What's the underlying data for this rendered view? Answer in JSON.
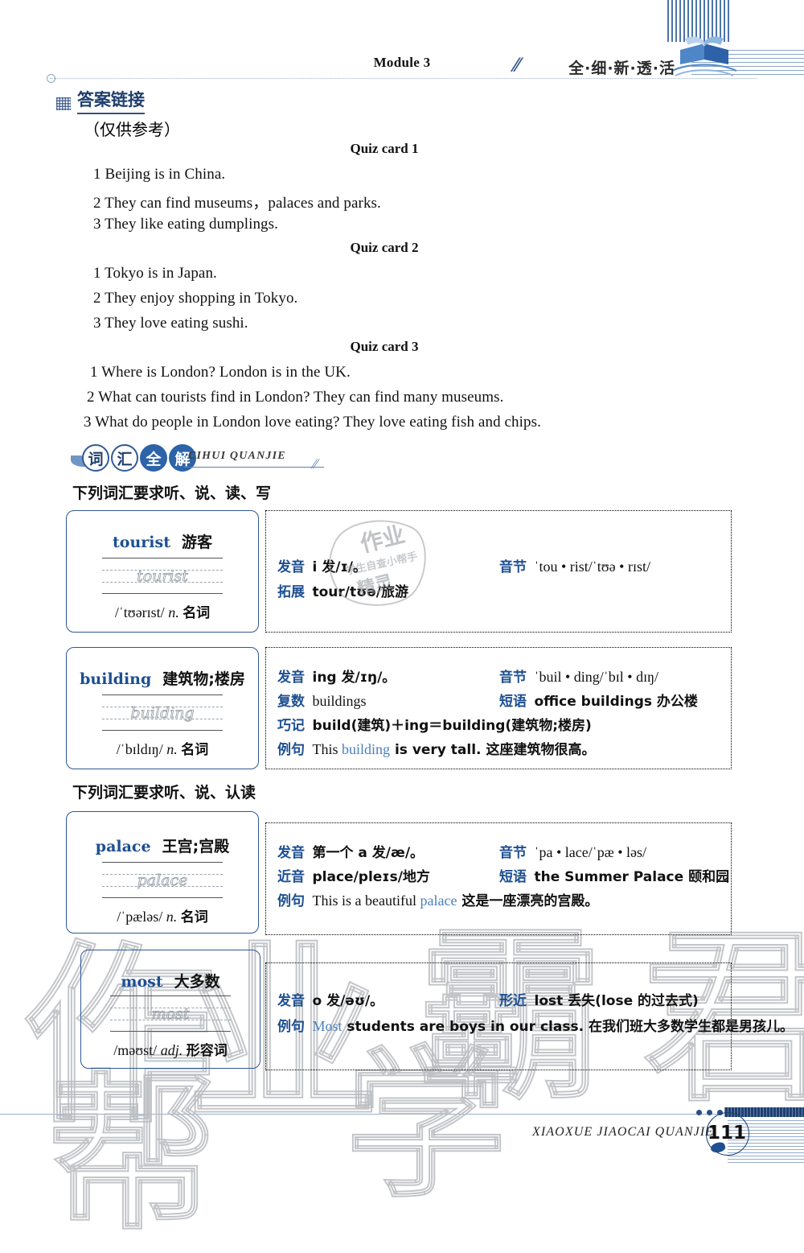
{
  "header": {
    "module_title": "Module 3",
    "brand_slogan": "全·细·新·透·活",
    "book_logo_icon": "open-book-icon"
  },
  "answers": {
    "section_icon": "dotted-grid-icon",
    "section_title": "答案链接",
    "note": "（仅供参考）",
    "cards": [
      {
        "title": "Quiz card 1",
        "lines": [
          "1 Beijing is in China.",
          "2 They can find museums，palaces and parks.",
          "3 They like eating dumplings."
        ]
      },
      {
        "title": "Quiz card 2",
        "lines": [
          "1 Tokyo is in Japan.",
          "2 They enjoy shopping in Tokyo.",
          "3 They love eating sushi."
        ]
      },
      {
        "title": "Quiz card 3",
        "lines": [
          "1 Where is London?  London is in the UK.",
          "2 What can tourists find in London?  They can find many museums.",
          "3 What do people in London love eating?  They love eating fish and chips."
        ]
      }
    ]
  },
  "vocab": {
    "banner_chars": [
      "词",
      "汇",
      "全",
      "解"
    ],
    "banner_pinyin": "CIHUI  QUANJIE",
    "section_label_1": "下列词汇要求听、说、读、写",
    "section_label_2": "下列词汇要求听、说、认读",
    "entries": [
      {
        "word": "tourist",
        "meaning": "游客",
        "trace": "tourist",
        "ipa": "/ˈtʊərɪst/",
        "pos": "n.",
        "pos_cn": "名词",
        "rows_left": [
          {
            "label": "发音",
            "text": "i 发/ɪ/。"
          },
          {
            "label": "拓展",
            "text": "tour/tʊə/旅游"
          }
        ],
        "rows_right": [
          {
            "label": "音节",
            "text": "ˈtou • rist/ˈtʊə • rɪst/"
          }
        ],
        "example": null
      },
      {
        "word": "building",
        "meaning": "建筑物;楼房",
        "trace": "building",
        "ipa": "/ˈbɪldɪŋ/",
        "pos": "n.",
        "pos_cn": "名词",
        "rows_left": [
          {
            "label": "发音",
            "text": "ing 发/ɪŋ/。"
          },
          {
            "label": "复数",
            "text": "buildings"
          }
        ],
        "rows_right": [
          {
            "label": "音节",
            "text": "ˈbuil • ding/ˈbɪl • dɪŋ/"
          },
          {
            "label": "短语",
            "text": "office buildings 办公楼"
          }
        ],
        "row_wide": {
          "label": "巧记",
          "text": "build(建筑)＋ing＝building(建筑物;楼房)"
        },
        "example": {
          "label": "例句",
          "pre": "This ",
          "highlight": "building",
          "post": " is very tall. 这座建筑物很高。"
        }
      },
      {
        "word": "palace",
        "meaning": "王宫;宫殿",
        "trace": "palace",
        "ipa": "/ˈpæləs/",
        "pos": "n.",
        "pos_cn": "名词",
        "rows_left": [
          {
            "label": "发音",
            "text": "第一个 a 发/æ/。"
          },
          {
            "label": "近音",
            "text": "place/pleɪs/地方"
          }
        ],
        "rows_right": [
          {
            "label": "音节",
            "text": "ˈpa • lace/ˈpæ • ləs/"
          },
          {
            "label": "短语",
            "text": "the Summer Palace 颐和园"
          }
        ],
        "example": {
          "label": "例句",
          "pre": "This is a beautiful ",
          "highlight": "palace",
          "post": " 这是一座漂亮的宫殿。"
        }
      },
      {
        "word": "most",
        "meaning": "大多数",
        "trace": "most",
        "ipa": "/məʊst/",
        "pos": "adj.",
        "pos_cn": "形容词",
        "rows_left": [
          {
            "label": "发音",
            "text": "o 发/əʊ/。"
          }
        ],
        "rows_right": [
          {
            "label": "形近",
            "text": "lost 丢失(lose 的过去式)"
          }
        ],
        "example": {
          "label": "例句",
          "pre": "",
          "highlight": "Most",
          "post": " students are boys in our class. 在我们班大多数学生都是男孩儿。"
        }
      }
    ]
  },
  "footer": {
    "series_name": "XIAOXUE JIAOCAI QUANJIE",
    "page_number": "111"
  },
  "watermark": {
    "stamp_text": "作业",
    "big_chars": [
      "作",
      "业",
      "帮",
      "学",
      "霸",
      "君"
    ]
  }
}
